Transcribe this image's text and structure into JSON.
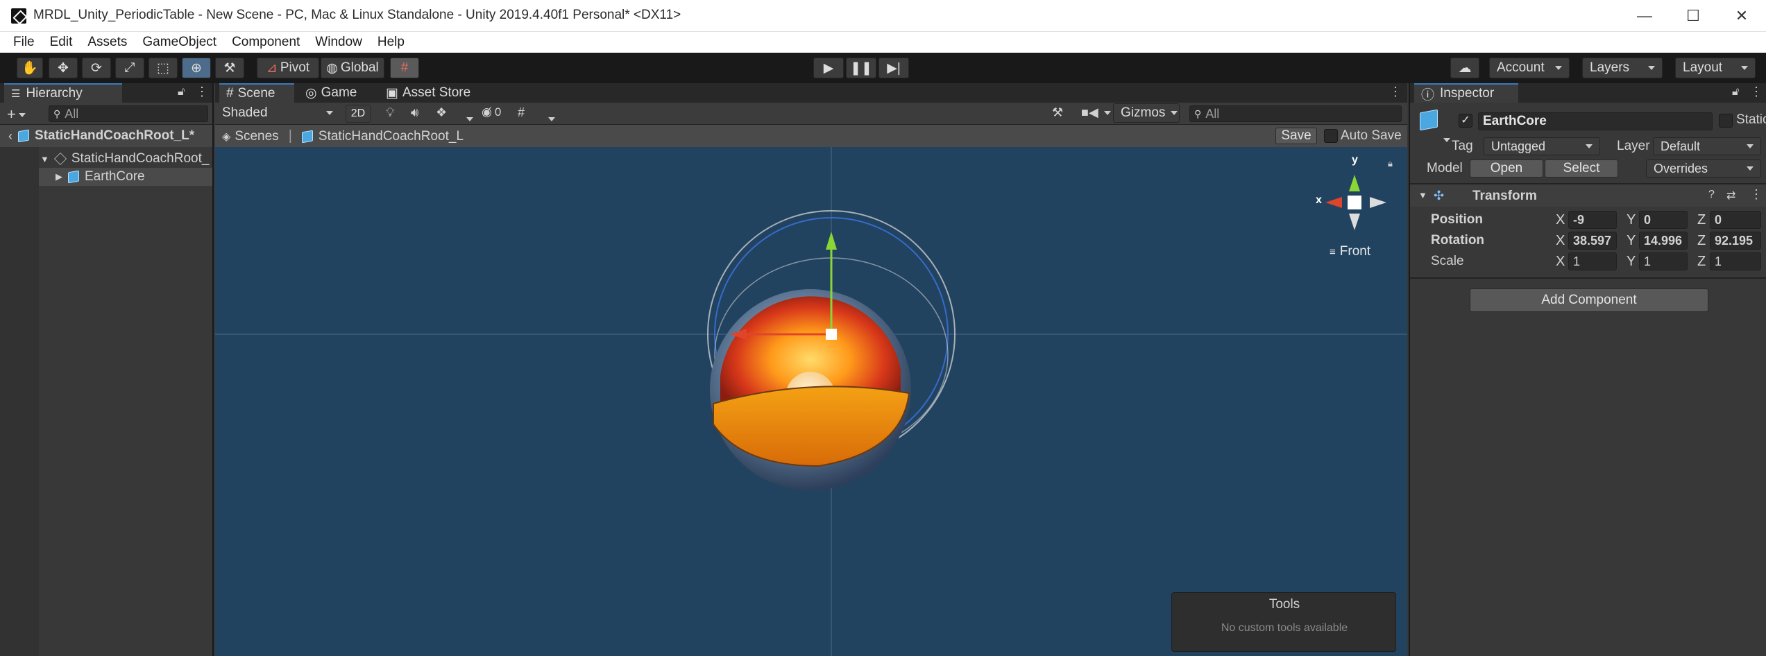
{
  "window": {
    "title": "MRDL_Unity_PeriodicTable - New Scene - PC, Mac & Linux Standalone - Unity 2019.4.40f1 Personal* <DX11>",
    "minimize": "—",
    "maximize": "☐",
    "close": "✕"
  },
  "menu": [
    "File",
    "Edit",
    "Assets",
    "GameObject",
    "Component",
    "Window",
    "Help"
  ],
  "toolbar": {
    "pivot": "Pivot",
    "global": "Global",
    "account": "Account",
    "layers": "Layers",
    "layout": "Layout"
  },
  "hierarchy": {
    "tab": "Hierarchy",
    "search_placeholder": "All",
    "scene_root": "StaticHandCoachRoot_L*",
    "items": [
      {
        "label": "StaticHandCoachRoot_"
      },
      {
        "label": "EarthCore"
      }
    ]
  },
  "scene": {
    "tabs": [
      "Scene",
      "Game",
      "Asset Store"
    ],
    "shading": "Shaded",
    "mode2d": "2D",
    "hidden_count": "0",
    "gizmos": "Gizmos",
    "search_placeholder": "All",
    "breadcrumb_root": "Scenes",
    "breadcrumb_prefab": "StaticHandCoachRoot_L",
    "save": "Save",
    "auto_save": "Auto Save",
    "view_label": "Front",
    "axis_x": "x",
    "axis_y": "y",
    "tools_title": "Tools",
    "tools_message": "No custom tools available"
  },
  "inspector": {
    "tab": "Inspector",
    "object_name": "EarthCore",
    "static_label": "Static",
    "tag_label": "Tag",
    "tag_value": "Untagged",
    "layer_label": "Layer",
    "layer_value": "Default",
    "model_label": "Model",
    "open": "Open",
    "select": "Select",
    "overrides": "Overrides",
    "component": "Transform",
    "rows": [
      {
        "label": "Position",
        "x": "-9",
        "y": "0",
        "z": "0"
      },
      {
        "label": "Rotation",
        "x": "38.597",
        "y": "14.996",
        "z": "92.195"
      },
      {
        "label": "Scale",
        "x": "1",
        "y": "1",
        "z": "1"
      }
    ],
    "axis_x": "X",
    "axis_y": "Y",
    "axis_z": "Z",
    "add_component": "Add Component"
  },
  "colors": {
    "accent": "#3a79bb",
    "scene_bg": "#22435f",
    "axis_x": "#e0452b",
    "axis_y": "#8ad637"
  }
}
